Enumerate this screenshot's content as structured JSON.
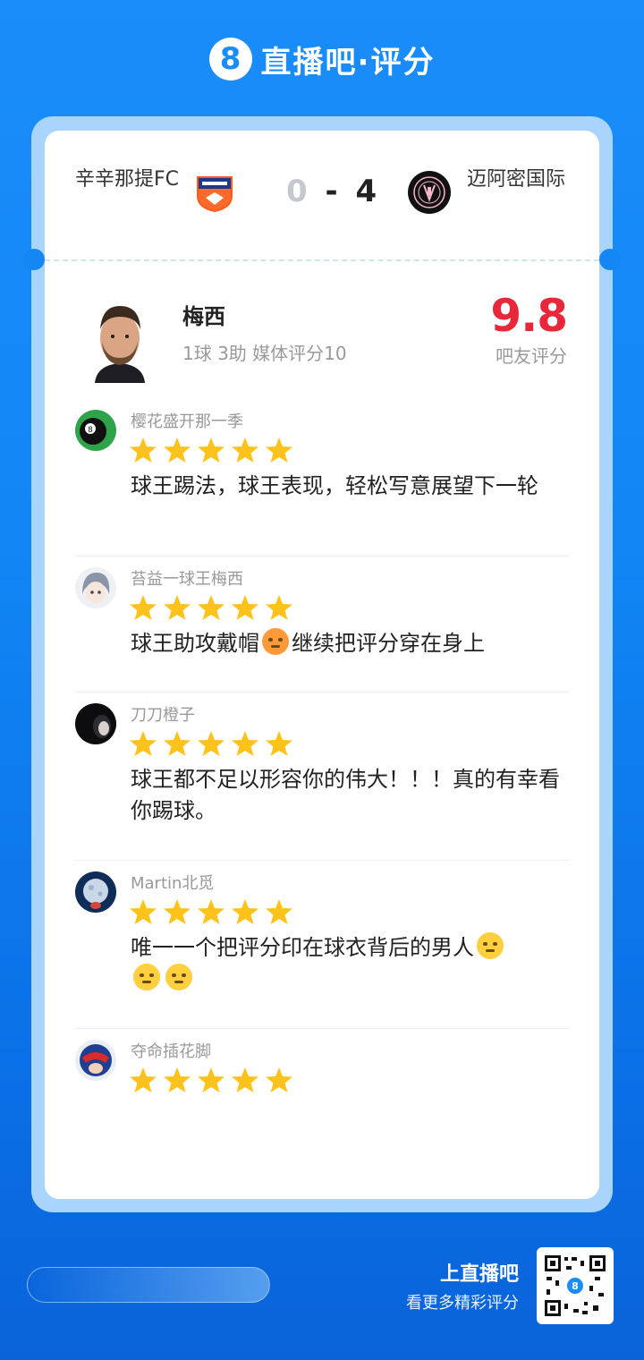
{
  "header": {
    "logo_glyph": "8",
    "title": "直播吧·评分"
  },
  "match": {
    "home_team": "辛辛那提FC",
    "home_score": "0",
    "score_sep": "-",
    "away_score": "4",
    "away_team": "迈阿密国际"
  },
  "player": {
    "name": "梅西",
    "stats": "1球 3助 媒体评分10",
    "rating": "9.8",
    "rating_label": "吧友评分"
  },
  "comments": [
    {
      "user": "樱花盛开那一季",
      "stars": 5,
      "text": "球王踢法，球王表现，轻松写意展望下一轮",
      "avatar_icon": "billiard-8-ball-icon"
    },
    {
      "user": "苔益一球王梅西",
      "stars": 5,
      "text_before": "球王助攻戴帽",
      "text_after": "继续把评分穿在身上",
      "avatar_icon": "anime-avatar-icon"
    },
    {
      "user": "刀刀橙子",
      "stars": 5,
      "text": "球王都不足以形容你的伟大！！！真的有幸看你踢球。",
      "avatar_icon": "dark-avatar-icon"
    },
    {
      "user": "Martin北觅",
      "stars": 5,
      "text": "唯一一个把评分印在球衣背后的男人",
      "avatar_icon": "moon-avatar-icon"
    },
    {
      "user": "夺命插花脚",
      "stars": 5,
      "text": "",
      "avatar_icon": "bull-avatar-icon"
    }
  ],
  "footer": {
    "title": "上直播吧",
    "subtitle": "看更多精彩评分"
  },
  "colors": {
    "brand_blue": "#1a8dfa",
    "rating_red": "#e8283a",
    "star_yellow": "#ffc21a"
  }
}
